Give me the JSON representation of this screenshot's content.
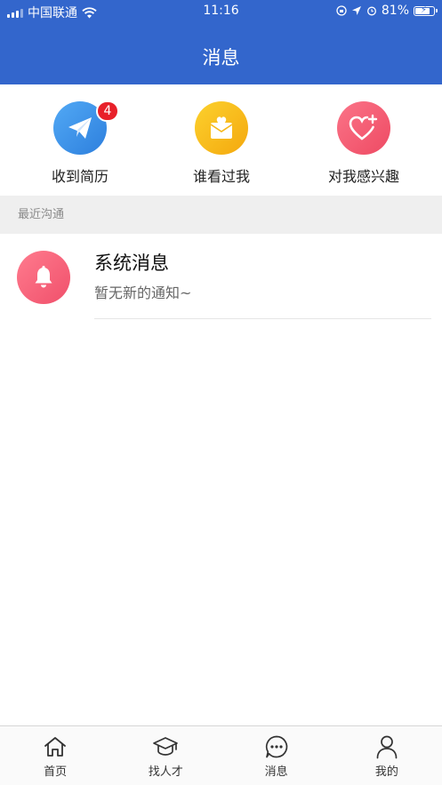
{
  "status_bar": {
    "carrier": "中国联通",
    "time": "11:16",
    "battery_percent": "81%",
    "battery_level": 0.81
  },
  "header": {
    "title": "消息"
  },
  "quick_entries": [
    {
      "label": "收到简历",
      "icon": "paper-plane-icon",
      "color": "#3d8fe6",
      "badge": "4"
    },
    {
      "label": "谁看过我",
      "icon": "envelope-heart-icon",
      "color": "#f6b81a"
    },
    {
      "label": "对我感兴趣",
      "icon": "heart-plus-icon",
      "color": "#f3586f"
    }
  ],
  "recent": {
    "section_title": "最近沟通",
    "items": [
      {
        "name": "系统消息",
        "preview": "暂无新的通知~",
        "icon": "bell-icon"
      }
    ]
  },
  "tabbar": {
    "items": [
      {
        "label": "首页",
        "icon": "home-icon"
      },
      {
        "label": "找人才",
        "icon": "graduation-cap-icon"
      },
      {
        "label": "消息",
        "icon": "chat-bubble-icon"
      },
      {
        "label": "我的",
        "icon": "user-icon"
      }
    ]
  },
  "colors": {
    "primary": "#3366cc",
    "badge": "#e8202a",
    "section_bg": "#efefef"
  }
}
